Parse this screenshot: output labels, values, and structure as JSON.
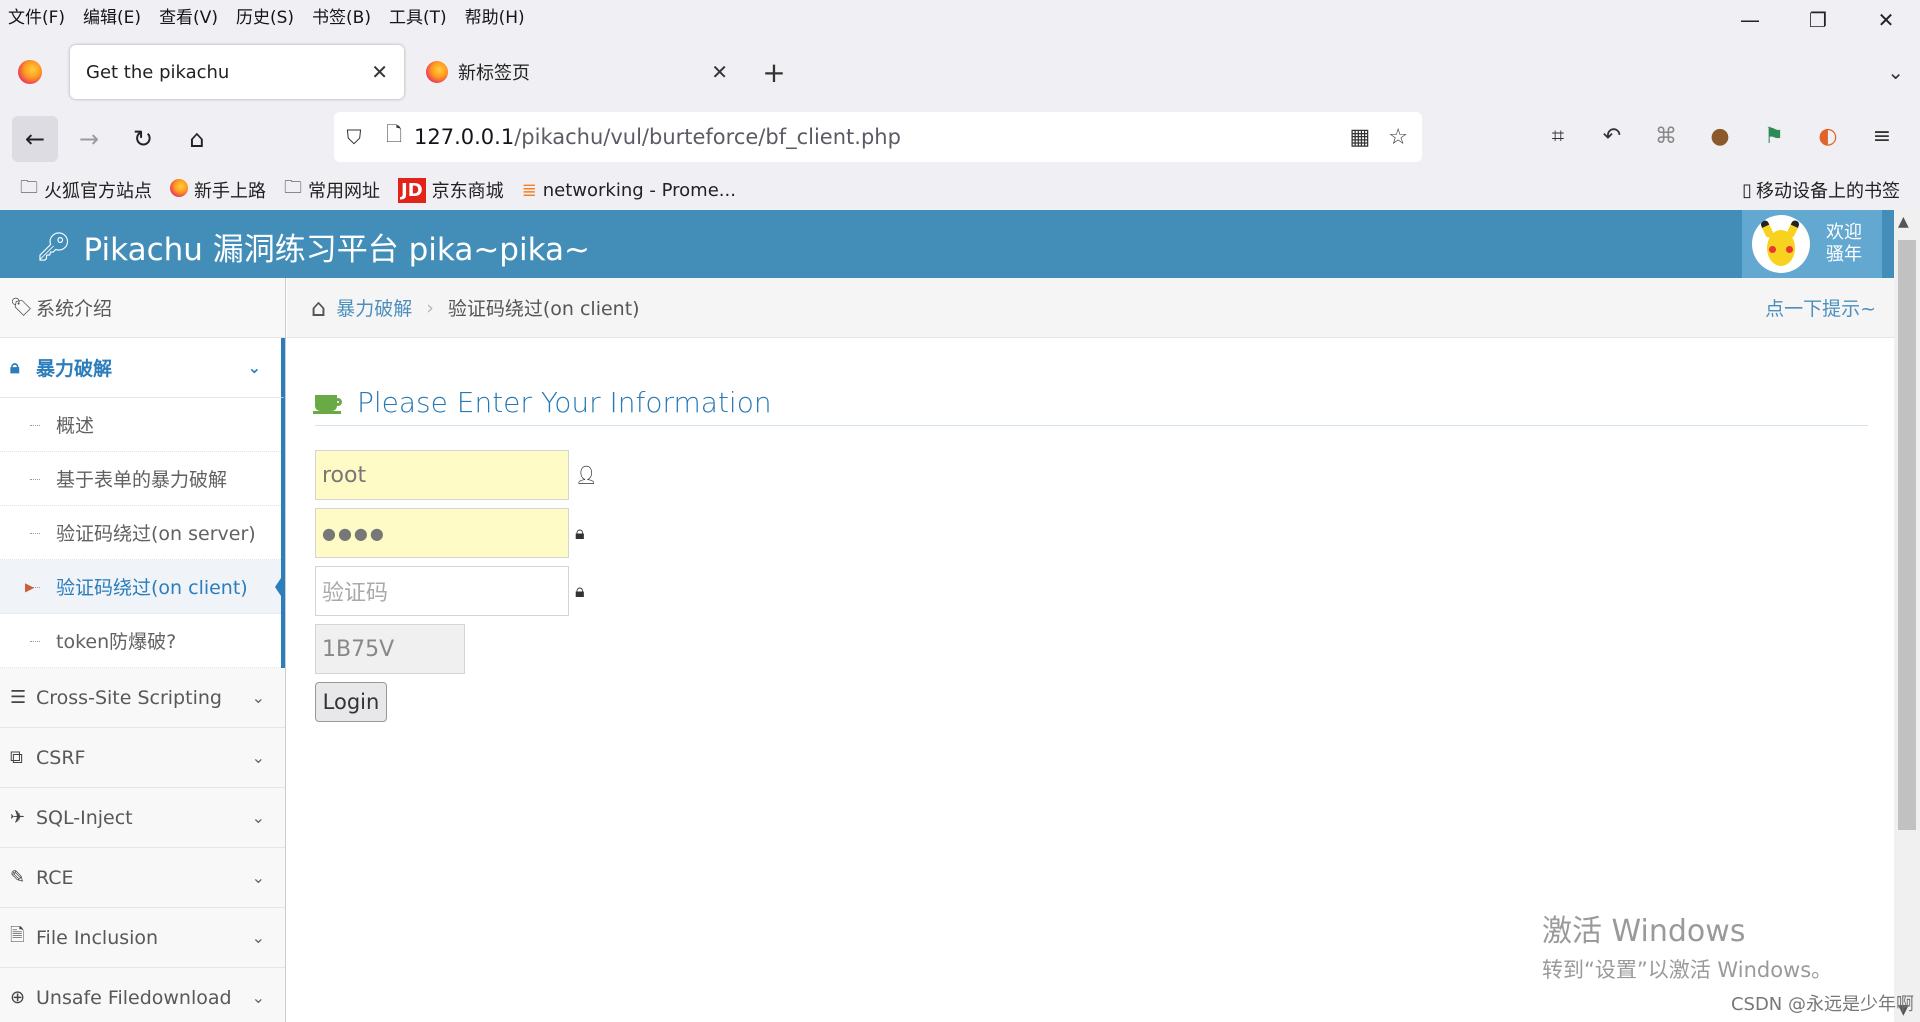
{
  "menubar": {
    "items": [
      "文件(F)",
      "编辑(E)",
      "查看(V)",
      "历史(S)",
      "书签(B)",
      "工具(T)",
      "帮助(H)"
    ]
  },
  "window": {
    "minimize": "—",
    "restore": "❐",
    "close": "✕"
  },
  "tabs": [
    {
      "label": "Get the pikachu",
      "active": true
    },
    {
      "label": "新标签页",
      "active": false
    }
  ],
  "urlbar": {
    "host": "127.0.0.1",
    "path": "/pikachu/vul/burteforce/bf_client.php"
  },
  "bookmarks": [
    {
      "label": "火狐官方站点",
      "icon": "folder-icon"
    },
    {
      "label": "新手上路",
      "icon": "firefox-icon"
    },
    {
      "label": "常用网址",
      "icon": "folder-icon"
    },
    {
      "label": "京东商城",
      "icon": "jd-icon"
    },
    {
      "label": "networking - Prome...",
      "icon": "stack-icon"
    }
  ],
  "mobile_bookmarks": "移动设备上的书签",
  "site": {
    "title": "Pikachu 漏洞练习平台 pika~pika~",
    "welcome_line1": "欢迎",
    "welcome_line2": "骚年"
  },
  "sidebar": {
    "intro": "系统介绍",
    "open_section": "暴力破解",
    "sub_items": [
      "概述",
      "基于表单的暴力破解",
      "验证码绕过(on server)",
      "验证码绕过(on client)",
      "token防爆破?"
    ],
    "sections": [
      "Cross-Site Scripting",
      "CSRF",
      "SQL-Inject",
      "RCE",
      "File Inclusion",
      "Unsafe Filedownload"
    ]
  },
  "breadcrumb": {
    "parent": "暴力破解",
    "current": "验证码绕过(on client)",
    "hint": "点一下提示~"
  },
  "form": {
    "heading": "Please Enter Your Information",
    "username_value": "root",
    "password_value": "●●●●",
    "captcha_placeholder": "验证码",
    "captcha_code": "1B75V",
    "login_label": "Login"
  },
  "watermark": {
    "line1": "激活 Windows",
    "line2": "转到“设置”以激活 Windows。"
  },
  "csdn": "CSDN @永远是少年啊",
  "colors": {
    "header_blue": "#438eb9",
    "link_blue": "#2b7dbc",
    "autofill_yellow": "#fffbc6"
  }
}
